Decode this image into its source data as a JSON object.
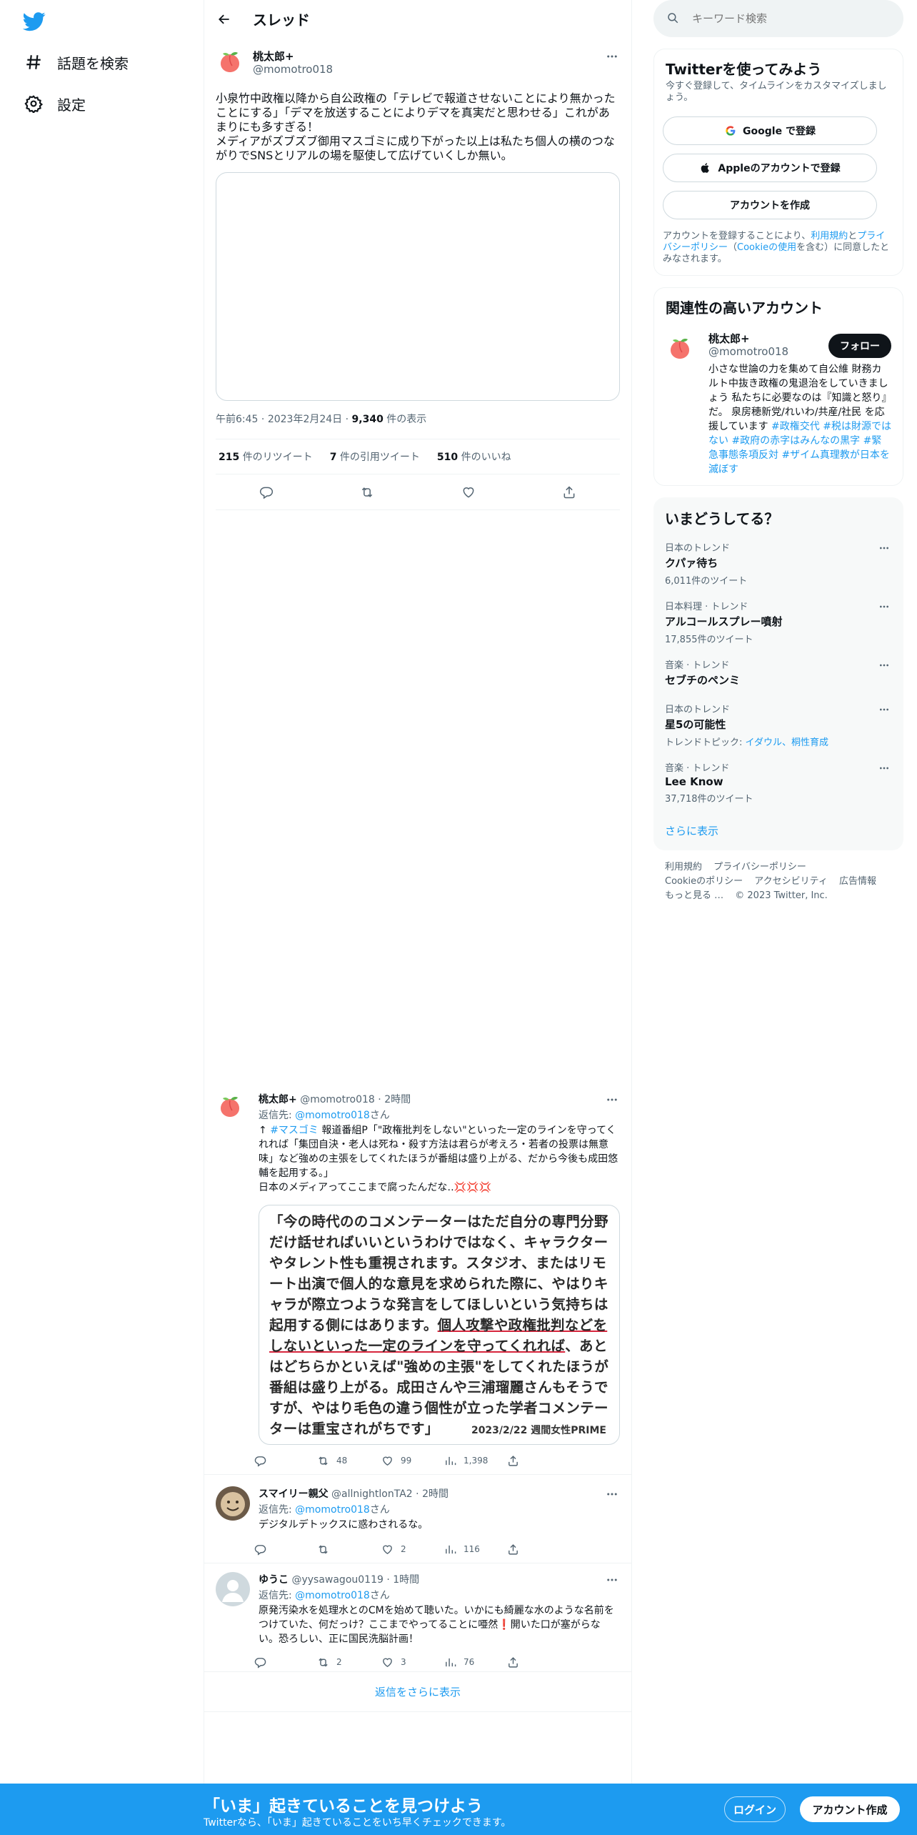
{
  "nav": {
    "explore_label": "話題を検索",
    "settings_label": "設定"
  },
  "header": {
    "title": "スレッド"
  },
  "main_tweet": {
    "name": "桃太郎+",
    "handle": "@momotro018",
    "text": "小泉竹中政権以降から自公政権の「テレビで報道させないことにより無かったことにする」「デマを放送することによりデマを真実だと思わせる」これがあまりにも多すぎる！\nメディアがズブズブ御用マスゴミに成り下がった以上は私たち個人の横のつながりでSNSとリアルの場を駆使して広げていくしか無い。",
    "time": "午前6:45",
    "date": "2023年2月24日",
    "views_count": "9,340",
    "views_label": "件の表示",
    "retweets_count": "215",
    "retweets_label": "件のリツイート",
    "quotes_count": "7",
    "quotes_label": "件の引用ツイート",
    "likes_count": "510",
    "likes_label": "件のいいね"
  },
  "replies": [
    {
      "name": "桃太郎+",
      "handle": "@momotro018",
      "time": "2時間",
      "reply_to_prefix": "返信先:",
      "reply_to_handle": "@momotro018",
      "reply_to_suffix": "さん",
      "text_arrow": "↑",
      "text_hashtag": "#マスゴミ",
      "text": "報道番組P「\"政権批判をしない\"といった一定のラインを守ってくれれば「集団自決・老人は死ね・殺す方法は君らが考えろ・若者の投票は無意味」など強めの主張をしてくれたほうが番組は盛り上がる、だから今後も成田悠輔を起用する。」\n日本のメディアってここまで腐ったんだな‥💢💢💢",
      "image_text_1": "「今の時代ののコメンテーターはただ自分の専門分野だけ話せればいいというわけではなく、キャラクターやタレント性も重視されます。スタジオ、またはリモート出演で個人的な意見を求められた際に、やはりキャラが際立つような発言をしてほしいという気持ちは起用する側にはあります。",
      "image_text_underlined": "個人攻撃や政権批判などをしないといった一定のラインを守ってくれれば",
      "image_text_2": "、あとはどちらかといえば\"強めの主張\"をしてくれたほうが番組は盛り上がる。成田さんや三浦瑠麗さんもそうですが、やはり毛色の違う個性が立った学者コメンテーターは重宝されがちです」",
      "image_caption": "2023/2/22 週間女性PRIME",
      "replies": "",
      "retweets": "48",
      "likes": "99",
      "views": "1,398"
    },
    {
      "name": "スマイリー親父",
      "handle": "@allnightlonTA2",
      "time": "2時間",
      "reply_to_prefix": "返信先:",
      "reply_to_handle": "@momotro018",
      "reply_to_suffix": "さん",
      "text": "デジタルデトックスに惑わされるな。",
      "replies": "",
      "retweets": "",
      "likes": "2",
      "views": "116"
    },
    {
      "name": "ゆうこ",
      "handle": "@yysawagou0119",
      "time": "1時間",
      "reply_to_prefix": "返信先:",
      "reply_to_handle": "@momotro018",
      "reply_to_suffix": "さん",
      "text": "原発汚染水を処理水とのCMを始めて聴いた。いかにも綺麗な水のような名前をつけていた、何だっけ？ここまでやってることに唖然❗開いた口が塞がらない。恐ろしい、正に国民洗脳計画！",
      "replies": "",
      "retweets": "2",
      "likes": "3",
      "views": "76"
    }
  ],
  "show_more_replies": "返信をさらに表示",
  "search": {
    "placeholder": "キーワード検索"
  },
  "signup": {
    "title": "Twitterを使ってみよう",
    "subtitle": "今すぐ登録して、タイムラインをカスタマイズしましょう。",
    "google_label": "Google で登録",
    "apple_label": "Appleのアカウントで登録",
    "create_label": "アカウントを作成",
    "terms_prefix": "アカウントを登録することにより、",
    "terms_link1": "利用規約",
    "terms_mid1": "と",
    "terms_link2": "プライバシーポリシー",
    "terms_mid2": "（",
    "terms_link3": "Cookieの使用",
    "terms_suffix": "を含む）に同意したとみなされます。"
  },
  "related": {
    "title": "関連性の高いアカウント",
    "name": "桃太郎+",
    "handle": "@momotro018",
    "follow_label": "フォロー",
    "bio": "小さな世論の力を集めて自公維 財務カルト中抜き政権の鬼退治をしていきましょう 私たちに必要なのは『知識と怒り』だ。 泉房穂新党/れいわ/共産/社民 を応援しています",
    "bio_tags": "#政権交代 #税は財源ではない #政府の赤字はみんなの黒字 #緊急事態条項反対 #ザイム真理教が日本を滅ぼす"
  },
  "trends": {
    "title": "いまどうしてる？",
    "items": [
      {
        "category": "日本のトレンド",
        "name": "クパァ待ち",
        "count": "6,011件のツイート"
      },
      {
        "category": "日本料理 · トレンド",
        "name": "アルコールスプレー噴射",
        "count": "17,855件のツイート"
      },
      {
        "category": "音楽 · トレンド",
        "name": "セブチのペンミ",
        "count": ""
      },
      {
        "category": "日本のトレンド",
        "name": "星5の可能性",
        "count_prefix": "トレンドトピック: ",
        "count_links": "イダウル、桐性育成"
      },
      {
        "category": "音楽 · トレンド",
        "name": "Lee Know",
        "count": "37,718件のツイート"
      }
    ],
    "show_more": "さらに表示"
  },
  "footer": {
    "links": [
      "利用規約",
      "プライバシーポリシー",
      "Cookieのポリシー",
      "アクセシビリティ",
      "広告情報",
      "もっと見る …",
      "© 2023 Twitter, Inc."
    ]
  },
  "bottom_bar": {
    "title": "「いま」起きていることを見つけよう",
    "subtitle": "Twitterなら、「いま」起きていることをいち早くチェックできます。",
    "login_label": "ログイン",
    "signup_label": "アカウント作成"
  },
  "colors": {
    "accent": "#1d9bf0",
    "text": "#0f1419",
    "muted": "#536471",
    "border": "#eff3f4"
  }
}
